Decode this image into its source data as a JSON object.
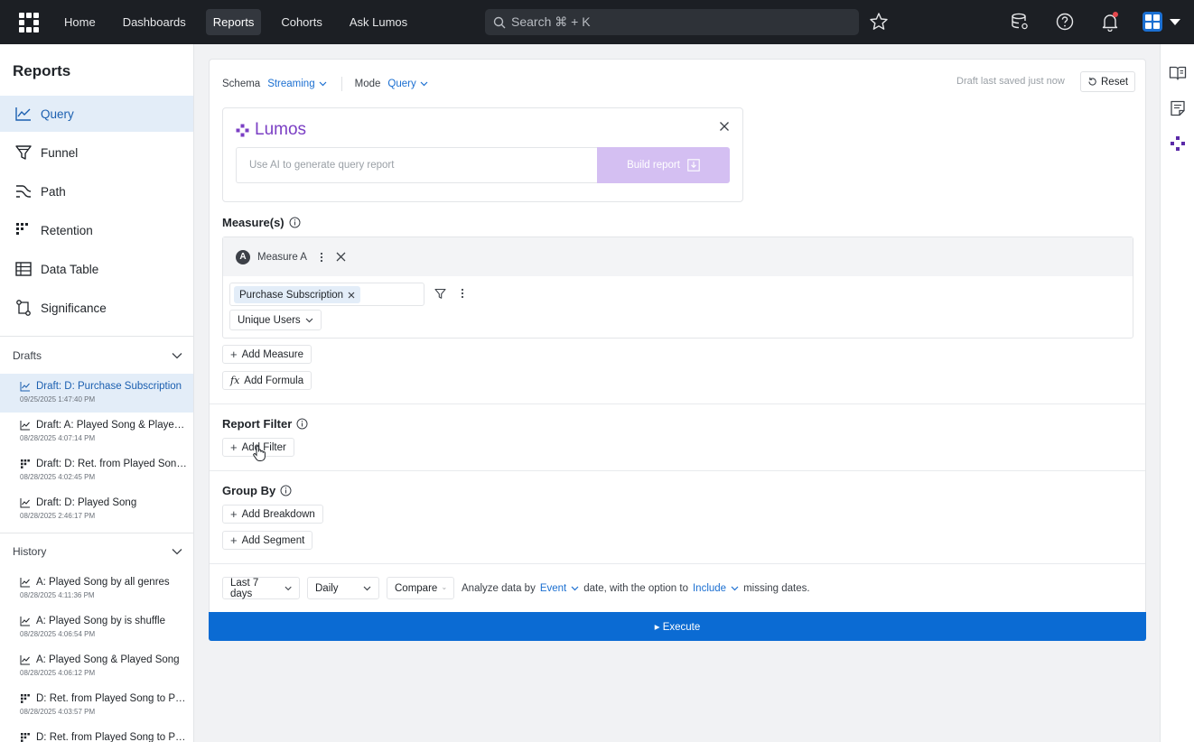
{
  "nav": {
    "items": [
      {
        "label": "Home",
        "active": false
      },
      {
        "label": "Dashboards",
        "active": false
      },
      {
        "label": "Reports",
        "active": true
      },
      {
        "label": "Cohorts",
        "active": false
      },
      {
        "label": "Ask Lumos",
        "active": false
      }
    ],
    "search_placeholder": "Search ⌘ + K"
  },
  "sidebar": {
    "title": "Reports",
    "items": [
      {
        "label": "Query",
        "icon": "line-chart-icon",
        "active": true
      },
      {
        "label": "Funnel",
        "icon": "funnel-icon",
        "active": false
      },
      {
        "label": "Path",
        "icon": "path-icon",
        "active": false
      },
      {
        "label": "Retention",
        "icon": "retention-icon",
        "active": false
      },
      {
        "label": "Data Table",
        "icon": "table-icon",
        "active": false
      },
      {
        "label": "Significance",
        "icon": "significance-icon",
        "active": false
      }
    ],
    "drafts": {
      "label": "Drafts",
      "entries": [
        {
          "label": "Draft: D: Purchase Subscription",
          "time": "09/25/2025 1:47:40 PM",
          "icon": "line",
          "active": true
        },
        {
          "label": "Draft: A: Played Song & Played ...",
          "time": "08/28/2025 4:07:14 PM",
          "icon": "line",
          "active": false
        },
        {
          "label": "Draft: D: Ret. from Played Song ...",
          "time": "08/28/2025 4:02:45 PM",
          "icon": "grid",
          "active": false
        },
        {
          "label": "Draft: D: Played Song",
          "time": "08/28/2025 2:46:17 PM",
          "icon": "line",
          "active": false
        }
      ]
    },
    "history": {
      "label": "History",
      "entries": [
        {
          "label": "A: Played Song by all genres",
          "time": "08/28/2025 4:11:36 PM",
          "icon": "line"
        },
        {
          "label": "A: Played Song by is shuffle",
          "time": "08/28/2025 4:06:54 PM",
          "icon": "line"
        },
        {
          "label": "A: Played Song & Played Song",
          "time": "08/28/2025 4:06:12 PM",
          "icon": "line"
        },
        {
          "label": "D: Ret. from Played Song to Pla...",
          "time": "08/28/2025 4:03:57 PM",
          "icon": "grid"
        },
        {
          "label": "D: Ret. from Played Song to Pla...",
          "time": "",
          "icon": "grid"
        }
      ]
    }
  },
  "query": {
    "schema_label": "Schema",
    "schema_value": "Streaming",
    "mode_label": "Mode",
    "mode_value": "Query",
    "draft_saved": "Draft last saved just now",
    "reset_label": "Reset",
    "lumos": {
      "brand": "Lumos",
      "placeholder": "Use AI to generate query report",
      "build_label": "Build report"
    },
    "measures_title": "Measure(s)",
    "measure": {
      "badge": "A",
      "name": "Measure A",
      "event_chip": "Purchase Subscription",
      "aggregation": "Unique Users"
    },
    "add_measure": "Add Measure",
    "add_formula": "Add Formula",
    "report_filter_title": "Report Filter",
    "add_filter": "Add Filter",
    "group_by_title": "Group By",
    "add_breakdown": "Add Breakdown",
    "add_segment": "Add Segment",
    "date_range": "Last 7 days",
    "interval": "Daily",
    "compare": "Compare",
    "analyze_prefix": "Analyze data by",
    "analyze_by": "Event",
    "analyze_middle": "date, with the option to",
    "missing_option": "Include",
    "analyze_suffix": "missing dates.",
    "execute_label": "▸ Execute"
  },
  "colors": {
    "accent": "#1b6fd1",
    "execute": "#0b6bd3",
    "lumos_purple": "#7b3fc4",
    "build_disabled": "#d4bff2",
    "topbar": "#1c1f24"
  }
}
